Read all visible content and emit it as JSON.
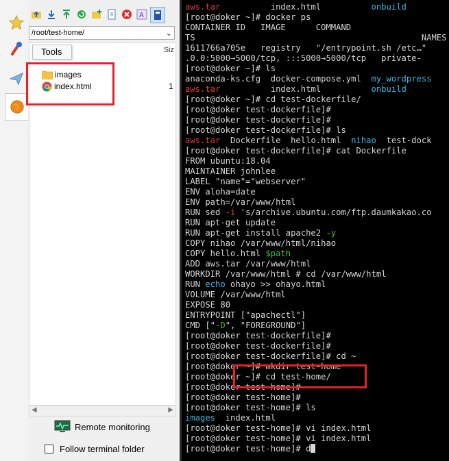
{
  "tooltip": "Tools",
  "path_box": {
    "value": "/root/test-home/"
  },
  "file_list": {
    "size_header": "Siz",
    "items": [
      {
        "name": "images",
        "type": "folder",
        "size": ""
      },
      {
        "name": "index.html",
        "type": "html",
        "size": "1"
      }
    ]
  },
  "bottom": {
    "remote_monitoring": "Remote monitoring",
    "follow_terminal_folder": "Follow terminal folder"
  },
  "terminal": {
    "colors": {
      "default": "#d6d6d6",
      "red": "#e03c3c",
      "cyan": "#39b7e6",
      "green": "#36c33a",
      "magenta": "#d543d5"
    },
    "lines": [
      [
        {
          "t": "aws.tar",
          "c": "red"
        },
        {
          "t": "          index.html          ",
          "c": "default"
        },
        {
          "t": "onbuild",
          "c": "cyan"
        }
      ],
      [
        {
          "t": "[root@doker ~]# docker ps",
          "c": "default"
        }
      ],
      [
        {
          "t": "CONTAINER ID   IMAGE      COMMAND",
          "c": "default"
        }
      ],
      [
        {
          "t": "TS                                             NAMES",
          "c": "default"
        }
      ],
      [
        {
          "t": "1611766a705e   registry   \"/entrypoint.sh /etc…\"",
          "c": "default"
        }
      ],
      [
        {
          "t": ".0.0:5000→5000/tcp, :::5000→5000/tcp   private-",
          "c": "default"
        }
      ],
      [
        {
          "t": "[root@doker ~]# ls",
          "c": "default"
        }
      ],
      [
        {
          "t": "anaconda-ks.cfg  docker-compose.yml  ",
          "c": "default"
        },
        {
          "t": "my_wordpress",
          "c": "cyan"
        }
      ],
      [
        {
          "t": "aws.tar",
          "c": "red"
        },
        {
          "t": "          index.html          ",
          "c": "default"
        },
        {
          "t": "onbuild",
          "c": "cyan"
        }
      ],
      [
        {
          "t": "[root@doker ~]# cd test-dockerfile/",
          "c": "default"
        }
      ],
      [
        {
          "t": "[root@doker test-dockerfile]#",
          "c": "default"
        }
      ],
      [
        {
          "t": "[root@doker test-dockerfile]#",
          "c": "default"
        }
      ],
      [
        {
          "t": "[root@doker test-dockerfile]# ls",
          "c": "default"
        }
      ],
      [
        {
          "t": "aws.tar",
          "c": "red"
        },
        {
          "t": "  Dockerfile  hello.html  ",
          "c": "default"
        },
        {
          "t": "nihao",
          "c": "cyan"
        },
        {
          "t": "  test-dock",
          "c": "default"
        }
      ],
      [
        {
          "t": "[root@doker test-dockerfile]# cat Dockerfile",
          "c": "default"
        }
      ],
      [
        {
          "t": "FROM ubuntu:18.04",
          "c": "default"
        }
      ],
      [
        {
          "t": "MAINTAINER johnlee",
          "c": "default"
        }
      ],
      [
        {
          "t": "LABEL \"name\"=\"webserver\"",
          "c": "default"
        }
      ],
      [
        {
          "t": "ENV aloha=date",
          "c": "default"
        }
      ],
      [
        {
          "t": "ENV path=/var/www/html",
          "c": "default"
        }
      ],
      [
        {
          "t": "RUN sed ",
          "c": "default"
        },
        {
          "t": "-i",
          "c": "red"
        },
        {
          "t": " 's/archive.ubuntu.com/ftp.daumkakao.co",
          "c": "default"
        }
      ],
      [
        {
          "t": "RUN apt-get update",
          "c": "default"
        }
      ],
      [
        {
          "t": "RUN apt-get install apache2 ",
          "c": "default"
        },
        {
          "t": "-y",
          "c": "green"
        }
      ],
      [
        {
          "t": "COPY nihao /var/www/html/nihao",
          "c": "default"
        }
      ],
      [
        {
          "t": "COPY hello.html ",
          "c": "default"
        },
        {
          "t": "$path",
          "c": "green"
        }
      ],
      [
        {
          "t": "ADD aws.tar /var/www/html",
          "c": "default"
        }
      ],
      [
        {
          "t": "WORKDIR /var/www/html # cd /var/www/html",
          "c": "default"
        }
      ],
      [
        {
          "t": "RUN ",
          "c": "default"
        },
        {
          "t": "echo",
          "c": "cyan"
        },
        {
          "t": " ohayo >> ohayo.html",
          "c": "default"
        }
      ],
      [
        {
          "t": "VOLUME /var/www/html",
          "c": "default"
        }
      ],
      [
        {
          "t": "EXPOSE 80",
          "c": "default"
        }
      ],
      [
        {
          "t": "ENTRYPOINT [\"apachectl\"]",
          "c": "default"
        }
      ],
      [
        {
          "t": "CMD [\"",
          "c": "default"
        },
        {
          "t": "-D",
          "c": "green"
        },
        {
          "t": "\", \"FOREGROUND\"]",
          "c": "default"
        }
      ],
      [
        {
          "t": "[root@doker test-dockerfile]#",
          "c": "default"
        }
      ],
      [
        {
          "t": "[root@doker test-dockerfile]#",
          "c": "default"
        }
      ],
      [
        {
          "t": "[root@doker test-dockerfile]# cd ~",
          "c": "default"
        }
      ],
      [
        {
          "t": "[root@doker ~]# mkdir test-home",
          "c": "default"
        }
      ],
      [
        {
          "t": "[root@doker ~]# cd test-home/",
          "c": "default"
        }
      ],
      [
        {
          "t": "[root@doker test-home]#",
          "c": "default"
        }
      ],
      [
        {
          "t": "[root@doker test-home]#",
          "c": "default"
        }
      ],
      [
        {
          "t": "[root@doker test-home]# ls",
          "c": "default"
        }
      ],
      [
        {
          "t": "images",
          "c": "cyan"
        },
        {
          "t": "  index.html",
          "c": "default"
        }
      ],
      [
        {
          "t": "[root@doker test-home]# vi index.html",
          "c": "default"
        }
      ],
      [
        {
          "t": "[root@doker test-home]# vi index.html",
          "c": "default"
        }
      ],
      [
        {
          "t": "[root@doker test-home]# d",
          "c": "default"
        }
      ]
    ]
  }
}
